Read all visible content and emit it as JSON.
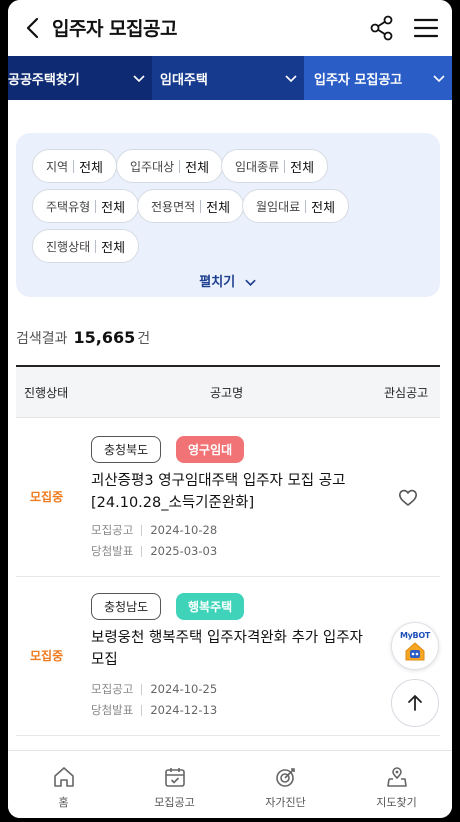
{
  "header": {
    "title": "입주자 모집공고",
    "back_icon": "chevron-left-icon",
    "share_icon": "share-icon",
    "menu_icon": "hamburger-menu-icon"
  },
  "breadcrumbs": [
    {
      "label": "공공주택찾기",
      "color": "#0d2a72"
    },
    {
      "label": "임대주택",
      "color": "#163a8e"
    },
    {
      "label": "입주자 모집공고",
      "color": "#2a5dc6"
    }
  ],
  "filters": [
    {
      "key": "지역",
      "value": "전체"
    },
    {
      "key": "입주대상",
      "value": "전체"
    },
    {
      "key": "임대종류",
      "value": "전체"
    },
    {
      "key": "주택유형",
      "value": "전체"
    },
    {
      "key": "전용면적",
      "value": "전체"
    },
    {
      "key": "월임대료",
      "value": "전체"
    },
    {
      "key": "진행상태",
      "value": "전체"
    }
  ],
  "expand_label": "펼치기",
  "results": {
    "label": "검색결과",
    "count": "15,665",
    "unit": "건"
  },
  "table_header": {
    "status": "진행상태",
    "title": "공고명",
    "interest": "관심공고"
  },
  "listings": [
    {
      "status": "모집중",
      "region": "충청북도",
      "type": "영구임대",
      "type_color": "#f27375",
      "title": "괴산증평3 영구임대주택 입주자 모집 공고[24.10.28_소득기준완화]",
      "notice_label": "모집공고",
      "notice_date": "2024-10-28",
      "announce_label": "당첨발표",
      "announce_date": "2025-03-03"
    },
    {
      "status": "모집중",
      "region": "충청남도",
      "type": "행복주택",
      "type_color": "#3fd4b9",
      "title": "보령웅천 행복주택 입주자격완화 추가 입주자 모집",
      "notice_label": "모집공고",
      "notice_date": "2024-10-25",
      "announce_label": "당첨발표",
      "announce_date": "2024-12-13"
    }
  ],
  "floating": {
    "mybot_label": "MyBOT",
    "top_icon": "arrow-up-icon"
  },
  "tabs": [
    {
      "label": "홈",
      "icon": "home-icon"
    },
    {
      "label": "모집공고",
      "icon": "calendar-check-icon"
    },
    {
      "label": "자가진단",
      "icon": "target-icon"
    },
    {
      "label": "지도찾기",
      "icon": "map-pin-icon"
    }
  ],
  "colors": {
    "accent_orange": "#f07a1e",
    "navy": "#1e3f8f",
    "filter_bg": "#eaf1fc"
  }
}
